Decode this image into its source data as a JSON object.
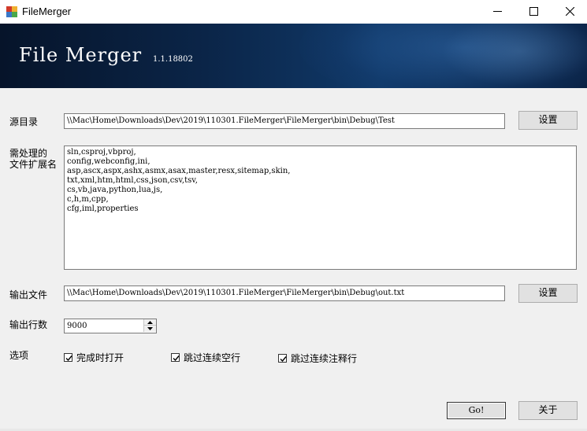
{
  "window": {
    "title": "FileMerger",
    "app_icon": "filemerger-app-icon",
    "controls": {
      "minimize": "minimize-icon",
      "maximize": "maximize-icon",
      "close": "close-icon"
    }
  },
  "banner": {
    "title": "File Merger",
    "version": "1.1.18802"
  },
  "source_dir": {
    "label": "源目录",
    "value": "\\\\Mac\\Home\\Downloads\\Dev\\2019\\110301.FileMerger\\FileMerger\\bin\\Debug\\Test",
    "button": "设置"
  },
  "extensions": {
    "label_line1": "需处理的",
    "label_line2": "文件扩展名",
    "lines": [
      "sln,csproj,vbproj,",
      "config,webconfig,ini,",
      "asp,ascx,aspx,ashx,asmx,asax,master,resx,sitemap,skin,",
      "txt,xml,htm,html,css,json,csv,tsv,",
      "cs,vb,java,python,lua,js,",
      "c,h,m,cpp,",
      "cfg,iml,properties"
    ]
  },
  "output_file": {
    "label": "输出文件",
    "value": "\\\\Mac\\Home\\Downloads\\Dev\\2019\\110301.FileMerger\\FileMerger\\bin\\Debug\\out.txt",
    "button": "设置"
  },
  "output_lines": {
    "label": "输出行数",
    "value": "9000"
  },
  "options": {
    "label": "选项",
    "items": [
      {
        "label": "完成时打开",
        "checked": true
      },
      {
        "label": "跳过连续空行",
        "checked": true
      },
      {
        "label": "跳过连续注释行",
        "checked": true
      }
    ]
  },
  "actions": {
    "go": "Go!",
    "about": "关于"
  }
}
